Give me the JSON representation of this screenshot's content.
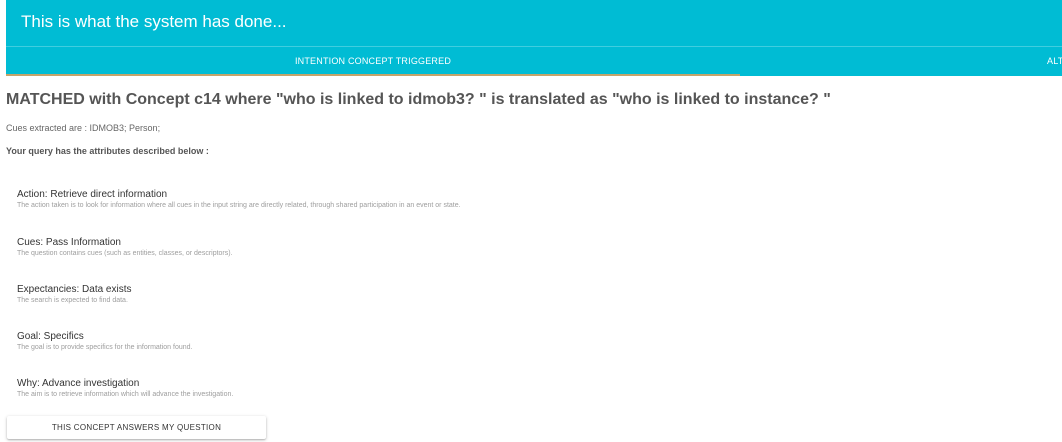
{
  "header": {
    "title": "This is what the system has done...",
    "tabs": [
      {
        "label": "INTENTION CONCEPT TRIGGERED",
        "active": true
      },
      {
        "label": "ALTERNATIVE CONCEPTS",
        "active": false
      }
    ]
  },
  "result": {
    "matched_heading": "MATCHED with Concept c14 where \"who is linked to idmob3? \" is translated as \"who is linked to instance? \"",
    "cues_line": "Cues extracted are : IDMOB3; Person;",
    "attributes_intro": "Your query has the attributes described below :",
    "attributes": [
      {
        "title": "Action: Retrieve direct information",
        "description": "The action taken is to look for information where all cues in the input string are directly related, through shared participation in an event or state."
      },
      {
        "title": "Cues: Pass Information",
        "description": "The question contains cues (such as entities, classes, or descriptors)."
      },
      {
        "title": "Expectancies: Data exists",
        "description": "The search is expected to find data."
      },
      {
        "title": "Goal: Specifics",
        "description": "The goal is to provide specifics for the information found."
      },
      {
        "title": "Why: Advance investigation",
        "description": "The aim is to retrieve information which will advance the investigation."
      }
    ],
    "answer_button_label": "THIS CONCEPT ANSWERS MY QUESTION"
  },
  "colors": {
    "header_bg": "#00bcd4",
    "header_text": "#ffffff",
    "tab_indicator": "#c4a46a"
  }
}
